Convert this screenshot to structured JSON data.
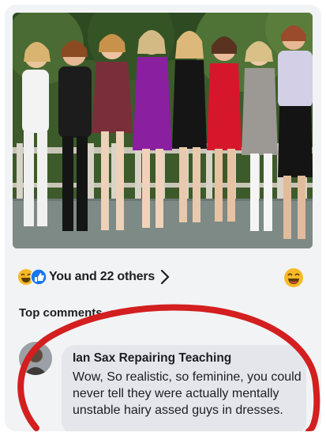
{
  "post": {
    "photo_alt": "",
    "reactions": {
      "emoji_icons": [
        "haha-icon",
        "like-icon"
      ],
      "summary_text": "You and 22 others",
      "viewer_reaction_icon": "haha-icon"
    }
  },
  "comments_section": {
    "sort_label": "Top comments"
  },
  "comment": {
    "author": "Ian Sax Repairing Teaching",
    "text": "Wow, So realistic, so feminine, you could never tell they were actually mentally unstable hairy assed guys in dresses."
  },
  "colors": {
    "like_blue": "#1877f2",
    "haha_yellow": "#f7b928",
    "annotation_red": "#d31f1f",
    "bubble": "#e4e6eb"
  }
}
